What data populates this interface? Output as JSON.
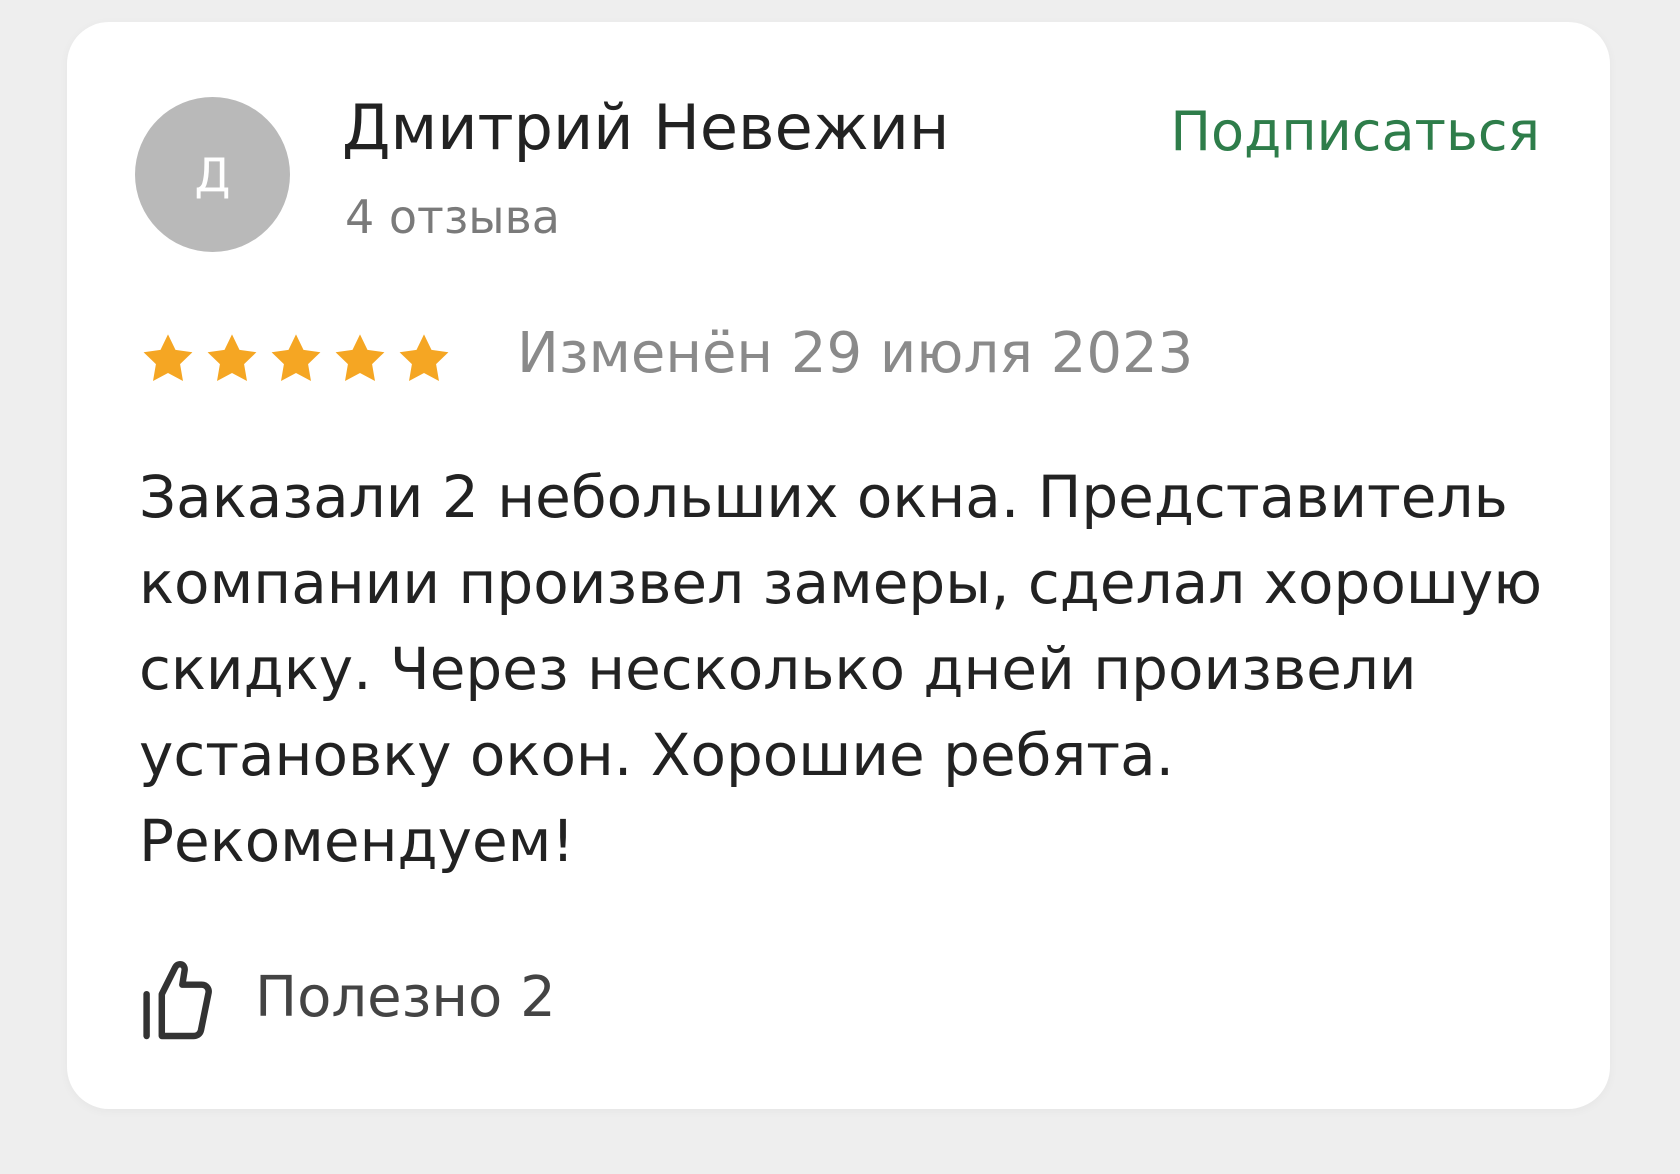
{
  "review": {
    "author": {
      "initial": "Д",
      "name": "Дмитрий Невежин",
      "reviews_count": "4 отзыва"
    },
    "subscribe_label": "Подписаться",
    "rating": 5,
    "max_rating": 5,
    "edited_date": "Изменён 29 июля 2023",
    "text": "Заказали 2 небольших окна. Представитель компании произвел замеры, сделал хорошую скидку. Через несколько дней произвели установку окон. Хорошие ребята. Рекомендуем!",
    "useful_label": "Полезно 2"
  },
  "colors": {
    "background": "#eeeeee",
    "card": "#ffffff",
    "avatar": "#b9b9b9",
    "subscribe": "#2e7d4a",
    "star": "#f5a623",
    "text": "#222222",
    "muted": "#8a8a8a"
  },
  "icons": {
    "star": "star-icon",
    "useful": "thumbs-up-icon"
  }
}
